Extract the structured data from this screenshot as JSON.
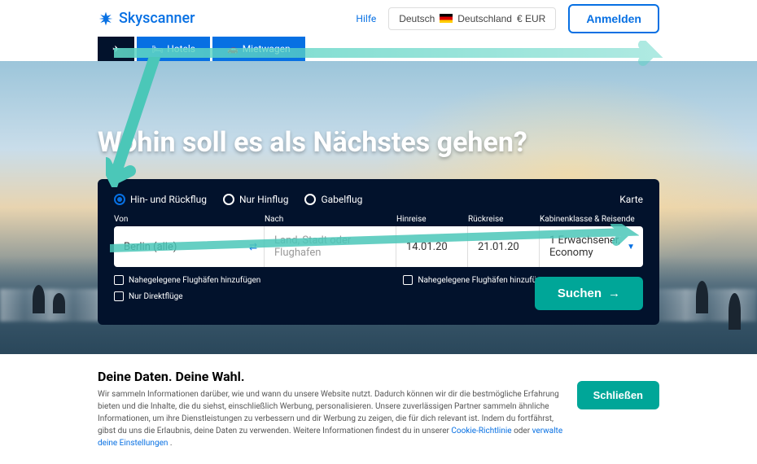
{
  "header": {
    "brand": "Skyscanner",
    "help_label": "Hilfe",
    "locale_lang": "Deutsch",
    "locale_country": "Deutschland",
    "locale_currency": "€ EUR",
    "login_label": "Anmelden"
  },
  "tabs": {
    "flights": "Flüge",
    "hotels": "Hotels",
    "cars": "Mietwagen"
  },
  "hero": {
    "title": "Wohin soll es als Nächstes gehen?"
  },
  "search": {
    "trip_roundtrip": "Hin- und Rückflug",
    "trip_oneway": "Nur Hinflug",
    "trip_multi": "Gabelflug",
    "map_label": "Karte",
    "from_label": "Von",
    "to_label": "Nach",
    "depart_label": "Hinreise",
    "return_label": "Rückreise",
    "cabin_label": "Kabinenklasse & Reisende",
    "from_value": "Berlin (alle)",
    "to_placeholder": "Land, Stadt oder Flughafen",
    "depart_value": "14.01.20",
    "return_value": "21.01.20",
    "cabin_value": "1 Erwachsener, Economy",
    "nearby_from": "Nahegelegene Flughäfen hinzufügen",
    "nearby_to": "Nahegelegene Flughäfen hinzufügen",
    "direct_only": "Nur Direktflüge",
    "search_btn": "Suchen"
  },
  "cookie": {
    "title": "Deine Daten. Deine Wahl.",
    "body_1": "Wir sammeln Informationen darüber, wie und wann du unsere Website nutzt. Dadurch können wir dir die bestmögliche Erfahrung bieten und die Inhalte, die du siehst, einschließlich Werbung, personalisieren. Unsere zuverlässigen Partner sammeln ähnliche Informationen, um ihre Dienstleistungen zu verbessern und dir Werbung zu zeigen, die für dich relevant ist. Indem du fortfährst, gibst du uns die Erlaubnis, deine Daten zu verwenden. Weitere Informationen findest du in unserer ",
    "link_policy": "Cookie-Richtlinie",
    "body_2": " oder ",
    "link_settings": "verwalte deine Einstellungen",
    "body_3": ".",
    "close_label": "Schließen"
  }
}
